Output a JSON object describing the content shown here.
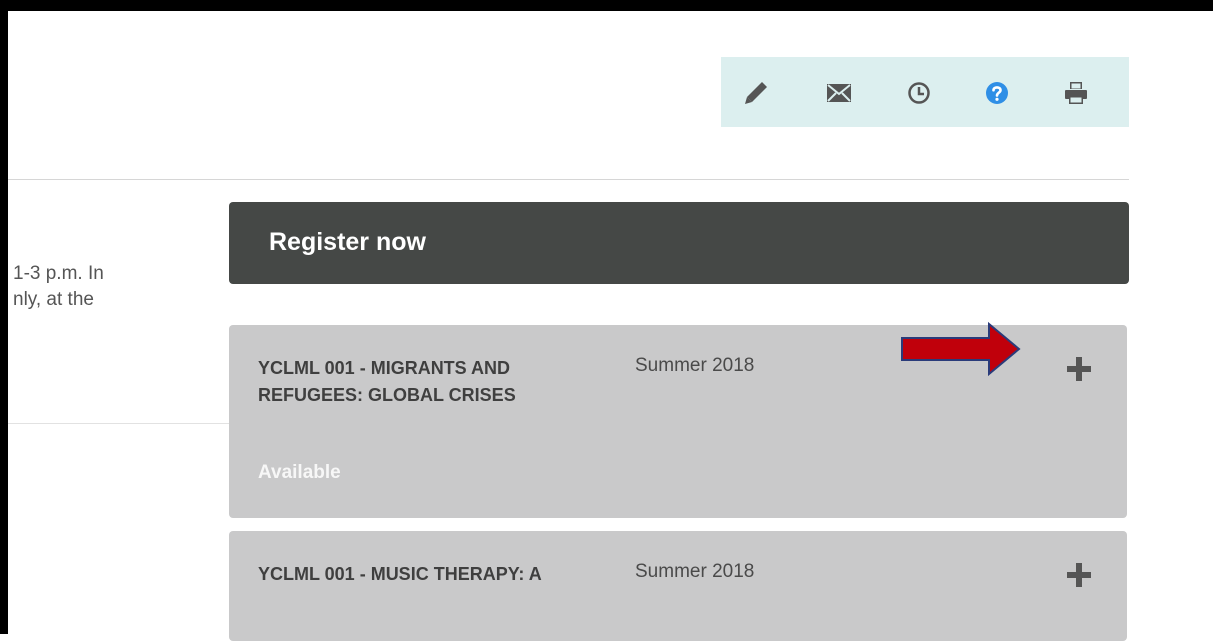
{
  "toolbar": {
    "icons": [
      "pencil-icon",
      "envelope-icon",
      "clock-icon",
      "help-icon",
      "print-icon"
    ],
    "background_color": "#dcefef",
    "help_color": "#2f8fe6"
  },
  "intro": {
    "text": "1-3 p.m. In\nnly, at the"
  },
  "register": {
    "title": "Register now",
    "background_color": "#454846"
  },
  "courses": [
    {
      "title": "YCLML 001 - MIGRANTS AND REFUGEES: GLOBAL CRISES",
      "term": "Summer 2018",
      "status": "Available"
    },
    {
      "title": "YCLML 001 - MUSIC THERAPY: A",
      "term": "Summer 2018"
    }
  ],
  "annotation": {
    "arrow_color": "#c0000b"
  }
}
